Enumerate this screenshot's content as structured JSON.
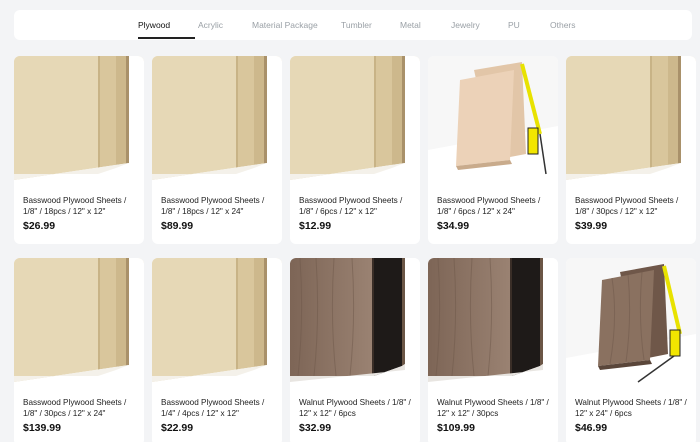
{
  "tabs": [
    {
      "label": "Plywood",
      "active": true
    },
    {
      "label": "Acrylic",
      "active": false
    },
    {
      "label": "Material Package",
      "active": false
    },
    {
      "label": "Tumbler",
      "active": false
    },
    {
      "label": "Metal",
      "active": false
    },
    {
      "label": "Jewelry",
      "active": false
    },
    {
      "label": "PU",
      "active": false
    },
    {
      "label": "Others",
      "active": false
    }
  ],
  "products": [
    {
      "title": "Basswood Plywood Sheets / 1/8\" / 18pcs / 12\" x 12\"",
      "price": "$26.99",
      "image": "basswood"
    },
    {
      "title": "Basswood Plywood Sheets / 1/8\" / 18pcs / 12\" x 24\"",
      "price": "$89.99",
      "image": "basswood"
    },
    {
      "title": "Basswood Plywood Sheets / 1/8\" / 6pcs / 12\" x 12\"",
      "price": "$12.99",
      "image": "basswood"
    },
    {
      "title": "Basswood Plywood Sheets / 1/8\" / 6pcs / 12\" x 24\"",
      "price": "$34.99",
      "image": "basswood-tape"
    },
    {
      "title": "Basswood Plywood Sheets / 1/8\" / 30pcs / 12\" x 12\"",
      "price": "$39.99",
      "image": "basswood"
    },
    {
      "title": "Basswood Plywood Sheets / 1/8\" / 30pcs / 12\" x 24\"",
      "price": "$139.99",
      "image": "basswood"
    },
    {
      "title": "Basswood Plywood Sheets / 1/4\" / 4pcs / 12\" x 12\"",
      "price": "$22.99",
      "image": "basswood"
    },
    {
      "title": "Walnut Plywood Sheets / 1/8\" / 12\" x 12\" / 6pcs",
      "price": "$32.99",
      "image": "walnut"
    },
    {
      "title": "Walnut Plywood Sheets / 1/8\" / 12\" x 12\" / 30pcs",
      "price": "$109.99",
      "image": "walnut"
    },
    {
      "title": "Walnut Plywood Sheets / 1/8\" / 12\" x 24\" / 6pcs",
      "price": "$46.99",
      "image": "walnut-tape"
    }
  ]
}
